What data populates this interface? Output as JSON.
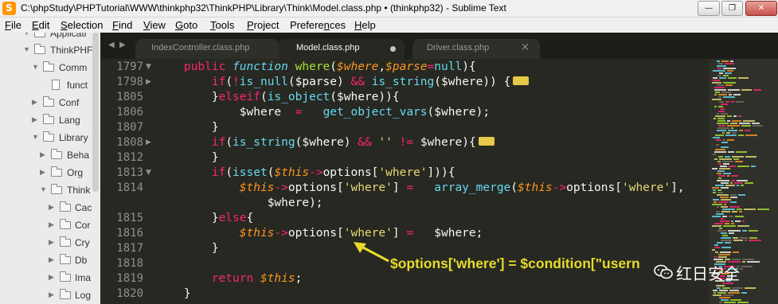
{
  "window": {
    "title": "C:\\phpStudy\\PHPTutorial\\WWW\\thinkphp32\\ThinkPHP\\Library\\Think\\Model.class.php • (thinkphp32) - Sublime Text",
    "app_icon": "S",
    "minimize_icon": "—",
    "maximize_icon": "❐",
    "close_icon": "✕"
  },
  "menu": [
    {
      "label": "File",
      "u": "F",
      "rest": "ile"
    },
    {
      "label": "Edit",
      "u": "E",
      "rest": "dit"
    },
    {
      "label": "Selection",
      "u": "S",
      "rest": "election"
    },
    {
      "label": "Find",
      "u": "F",
      "rest": "ind"
    },
    {
      "label": "View",
      "u": "V",
      "rest": "iew"
    },
    {
      "label": "Goto",
      "u": "G",
      "rest": "oto"
    },
    {
      "label": "Tools",
      "u": "T",
      "rest": "ools"
    },
    {
      "label": "Project",
      "u": "P",
      "rest": "roject"
    },
    {
      "label": "Preferences",
      "u": "n",
      "pre": "Prefere",
      "rest": "ces"
    },
    {
      "label": "Help",
      "u": "H",
      "rest": "elp"
    }
  ],
  "sidebar": {
    "items": [
      {
        "label": "Applicati",
        "type": "folder-partial",
        "expanded": true
      },
      {
        "label": "ThinkPHF",
        "type": "folder",
        "expanded": true
      },
      {
        "label": "Comm",
        "type": "folder",
        "expanded": true
      },
      {
        "label": "funct",
        "type": "file"
      },
      {
        "label": "Conf",
        "type": "folder",
        "expanded": false
      },
      {
        "label": "Lang",
        "type": "folder",
        "expanded": false
      },
      {
        "label": "Library",
        "type": "folder",
        "expanded": true
      },
      {
        "label": "Beha",
        "type": "folder",
        "expanded": false
      },
      {
        "label": "Org",
        "type": "folder",
        "expanded": false
      },
      {
        "label": "Think",
        "type": "folder",
        "expanded": true
      },
      {
        "label": "Cac",
        "type": "folder",
        "expanded": false
      },
      {
        "label": "Cor",
        "type": "folder",
        "expanded": false
      },
      {
        "label": "Cry",
        "type": "folder",
        "expanded": false
      },
      {
        "label": "Db",
        "type": "folder",
        "expanded": false
      },
      {
        "label": "Ima",
        "type": "folder",
        "expanded": false
      },
      {
        "label": "Log",
        "type": "folder",
        "expanded": false
      }
    ]
  },
  "tabs": {
    "nav_left": "◀",
    "nav_right": "▶",
    "items": [
      {
        "label": "IndexController.class.php",
        "active": false,
        "modified": false
      },
      {
        "label": "Model.class.php",
        "active": true,
        "modified": true
      },
      {
        "label": "Driver.class.php",
        "active": false,
        "modified": false
      }
    ],
    "close_glyph": "×"
  },
  "editor": {
    "lines": [
      {
        "num": "1797",
        "fold": "▼"
      },
      {
        "num": "1798",
        "fold": "▶"
      },
      {
        "num": "1805",
        "fold": ""
      },
      {
        "num": "1806",
        "fold": ""
      },
      {
        "num": "1807",
        "fold": ""
      },
      {
        "num": "1808",
        "fold": "▶"
      },
      {
        "num": "1812",
        "fold": ""
      },
      {
        "num": "1813",
        "fold": "▼"
      },
      {
        "num": "1814",
        "fold": ""
      },
      {
        "num": "",
        "fold": ""
      },
      {
        "num": "1815",
        "fold": ""
      },
      {
        "num": "1816",
        "fold": ""
      },
      {
        "num": "1817",
        "fold": ""
      },
      {
        "num": "1818",
        "fold": ""
      },
      {
        "num": "1819",
        "fold": ""
      },
      {
        "num": "1820",
        "fold": ""
      }
    ]
  },
  "annotation": {
    "text": "$options['where'] = $condition[\"usern",
    "color": "#e6db2a"
  },
  "watermark": {
    "text": "红日安全",
    "logo": "wechat-logo"
  },
  "colors": {
    "background": "#272822",
    "keyword": "#f92672",
    "function": "#66d9ef",
    "variable": "#fd971f",
    "string": "#e6db74",
    "fold_badge": "#e6c84a"
  }
}
